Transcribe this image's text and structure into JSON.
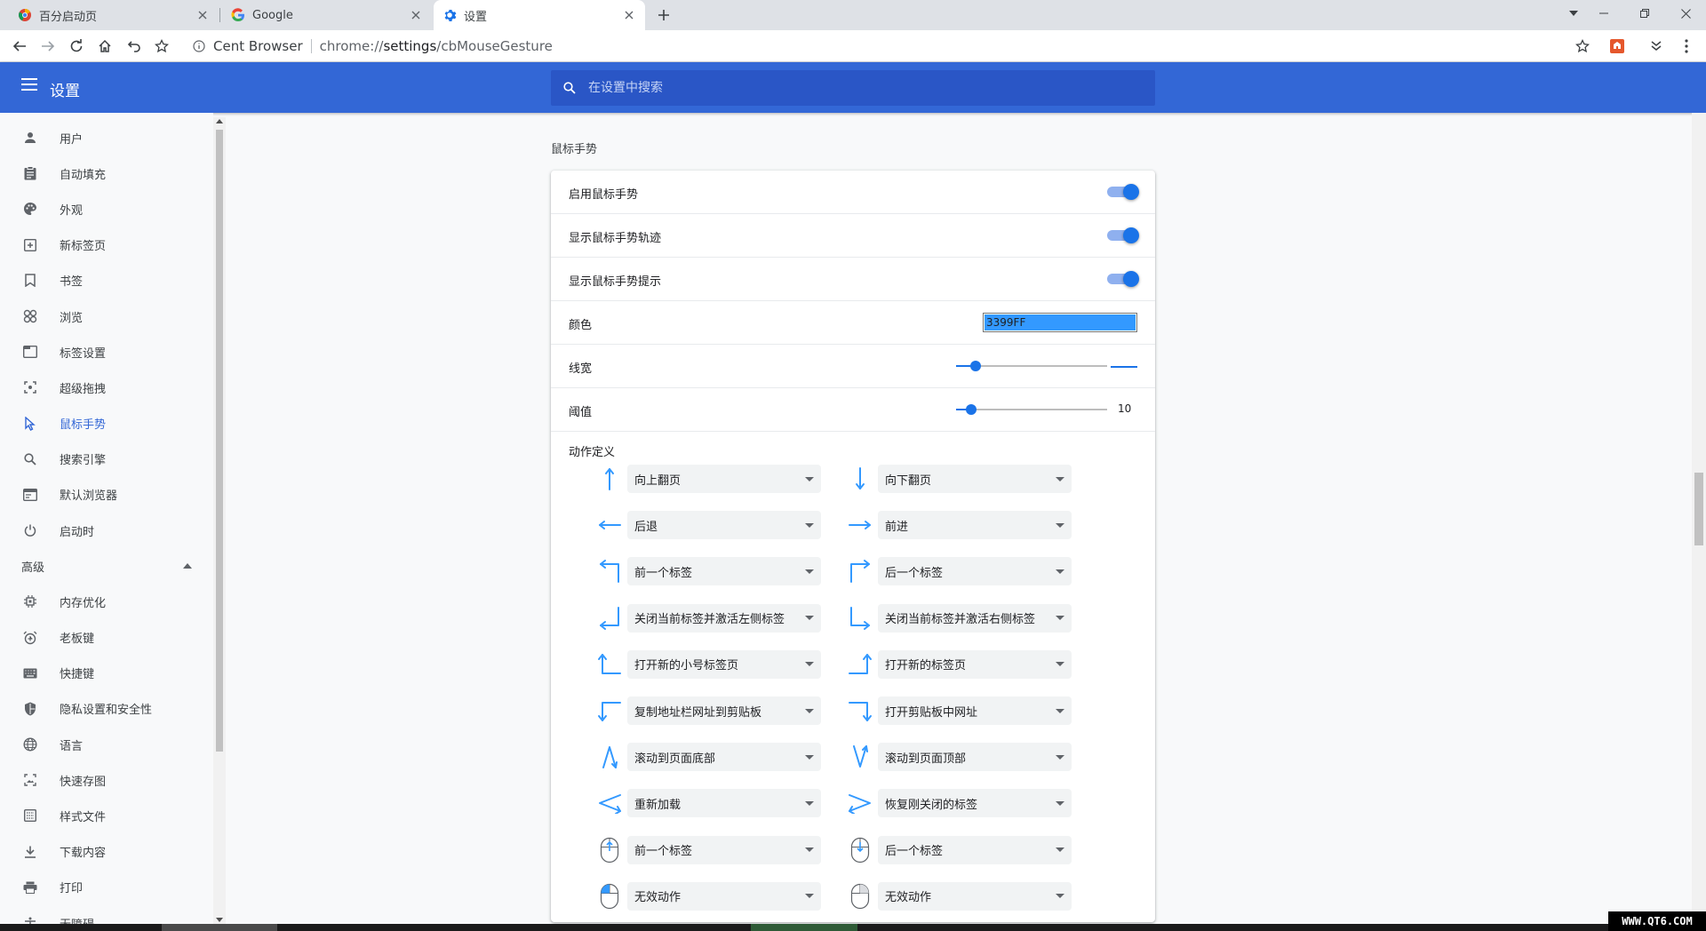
{
  "tabs": [
    {
      "title": "百分启动页"
    },
    {
      "title": "Google"
    },
    {
      "title": "设置"
    }
  ],
  "omnibox": {
    "site": "Cent Browser",
    "url_prefix": "chrome://",
    "url_host": "settings",
    "url_path": "/cbMouseGesture"
  },
  "header": {
    "title": "设置",
    "search_placeholder": "在设置中搜索"
  },
  "sidebar": {
    "items": [
      {
        "label": "用户"
      },
      {
        "label": "自动填充"
      },
      {
        "label": "外观"
      },
      {
        "label": "新标签页"
      },
      {
        "label": "书签"
      },
      {
        "label": "浏览"
      },
      {
        "label": "标签设置"
      },
      {
        "label": "超级拖拽"
      },
      {
        "label": "鼠标手势"
      },
      {
        "label": "搜索引擎"
      },
      {
        "label": "默认浏览器"
      },
      {
        "label": "启动时"
      }
    ],
    "advanced_label": "高级",
    "advanced_items": [
      {
        "label": "内存优化"
      },
      {
        "label": "老板键"
      },
      {
        "label": "快捷键"
      },
      {
        "label": "隐私设置和安全性"
      },
      {
        "label": "语言"
      },
      {
        "label": "快速存图"
      },
      {
        "label": "样式文件"
      },
      {
        "label": "下载内容"
      },
      {
        "label": "打印"
      },
      {
        "label": "无障碍"
      }
    ]
  },
  "section": {
    "title": "鼠标手势"
  },
  "settings": {
    "enable": {
      "label": "启用鼠标手势",
      "on": true
    },
    "trail": {
      "label": "显示鼠标手势轨迹",
      "on": true
    },
    "hint": {
      "label": "显示鼠标手势提示",
      "on": true
    },
    "color": {
      "label": "颜色",
      "value": "3399FF"
    },
    "width": {
      "label": "线宽",
      "level": 0.13
    },
    "threshold": {
      "label": "阈值",
      "value": "10",
      "level": 0.1
    }
  },
  "actions": {
    "label": "动作定义",
    "left": [
      "向上翻页",
      "后退",
      "前一个标签",
      "关闭当前标签并激活左侧标签",
      "打开新的小号标签页",
      "复制地址栏网址到剪贴板",
      "滚动到页面底部",
      "重新加载",
      "前一个标签",
      "无效动作"
    ],
    "right": [
      "向下翻页",
      "前进",
      "后一个标签",
      "关闭当前标签并激活右侧标签",
      "打开新的标签页",
      "打开剪贴板中网址",
      "滚动到页面顶部",
      "恢复刚关闭的标签",
      "后一个标签",
      "无效动作"
    ]
  },
  "colors": {
    "accent": "#3367d6",
    "gesture": "#3399ff"
  },
  "watermark": "WWW.QT6.COM"
}
